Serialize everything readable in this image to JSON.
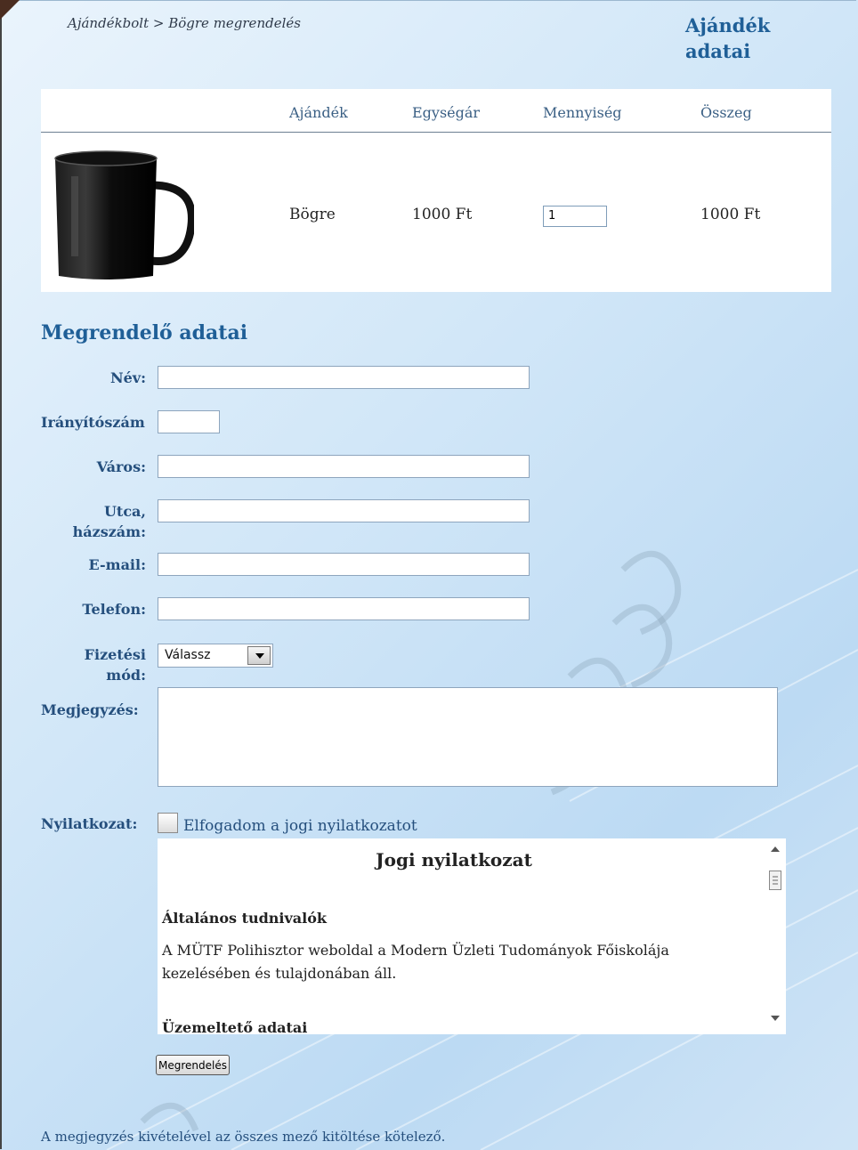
{
  "breadcrumb": "Ajándékbolt > Bögre megrendelés",
  "page_title": "Ajándék adatai",
  "product_table": {
    "headers": [
      "Ajándék",
      "Egységár",
      "Mennyiség",
      "Összeg"
    ],
    "row": {
      "image": "mug-image",
      "name": "Bögre",
      "unit_price": "1000 Ft",
      "quantity": "1",
      "total": "1000 Ft"
    }
  },
  "order_form": {
    "section_title": "Megrendelő adatai",
    "labels": {
      "name": "Név:",
      "zip": "Irányítószám",
      "city": "Város:",
      "street": "Utca, házszám:",
      "email": "E-mail:",
      "phone": "Telefon:",
      "payment": "Fizetési mód:",
      "note": "Megjegyzés:",
      "declaration": "Nyilatkozat:"
    },
    "values": {
      "name": "",
      "zip": "",
      "city": "",
      "street": "",
      "email": "",
      "phone": "",
      "note": ""
    },
    "payment_selected": "Válassz",
    "accept_label": "Elfogadom a jogi nyilatkozatot",
    "accept_checked": false,
    "submit_label": "Megrendelés"
  },
  "legal": {
    "title": "Jogi nyilatkozat",
    "section1_title": "Általános tudnivalók",
    "section1_text": "A MÜTF Polihisztor weboldal a Modern Üzleti Tudományok Főiskolája kezelésében és tulajdonában áll.",
    "section2_title": "Üzemeltető adatai"
  },
  "footer_note": "A megjegyzés kivételével az összes mező kitöltése kötelező.",
  "colors": {
    "heading": "#1f5f97",
    "label": "#254f7d",
    "panel": "#ffffff"
  }
}
